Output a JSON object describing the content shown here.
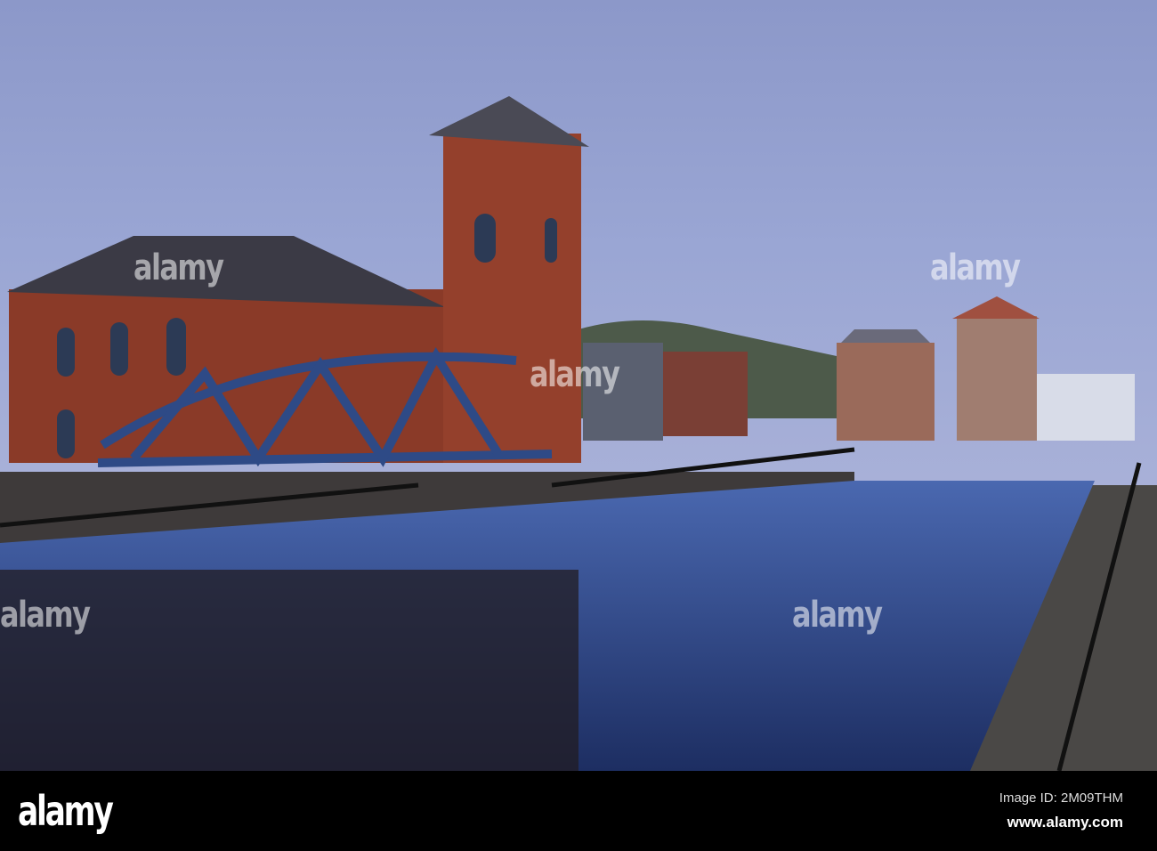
{
  "watermark": "alamy",
  "footer": {
    "logo": "alamy",
    "image_id": "Image ID: 2M09THM",
    "url": "www.alamy.com"
  },
  "colors": {
    "sky": "#8a9bcf",
    "brick": "#8a3a28",
    "bridge": "#2e4a86",
    "water": "#3c5fa8"
  }
}
